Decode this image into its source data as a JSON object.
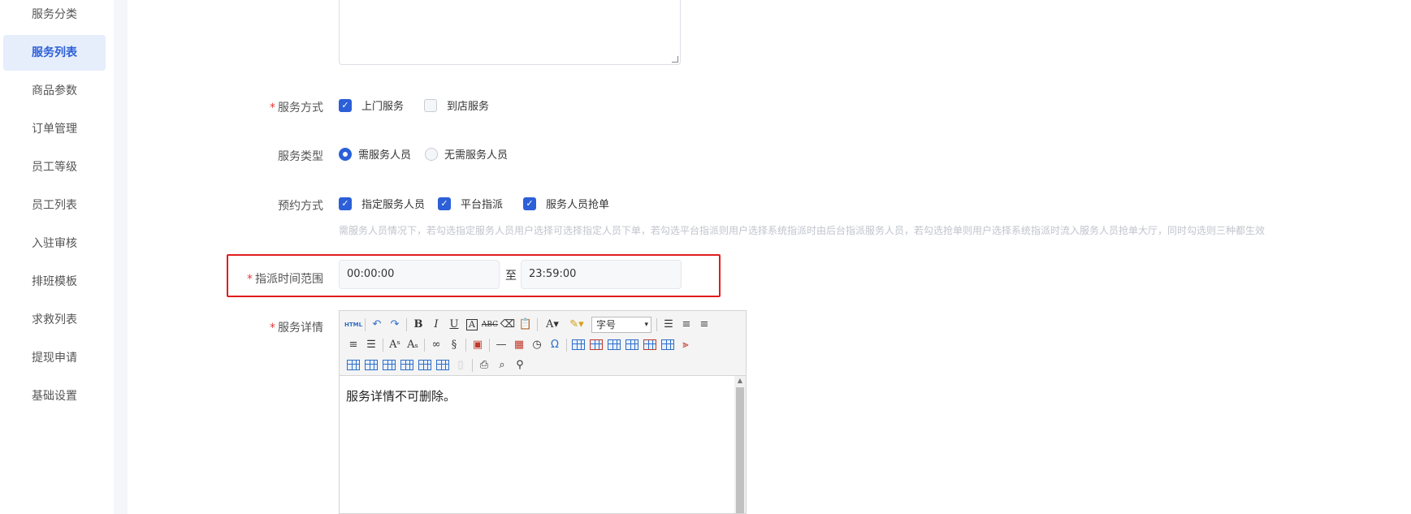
{
  "sidebar": {
    "items": [
      {
        "label": "服务分类",
        "active": false
      },
      {
        "label": "服务列表",
        "active": true
      },
      {
        "label": "商品参数",
        "active": false
      },
      {
        "label": "订单管理",
        "active": false
      },
      {
        "label": "员工等级",
        "active": false
      },
      {
        "label": "员工列表",
        "active": false
      },
      {
        "label": "入驻审核",
        "active": false
      },
      {
        "label": "排班模板",
        "active": false
      },
      {
        "label": "求救列表",
        "active": false
      },
      {
        "label": "提现申请",
        "active": false
      },
      {
        "label": "基础设置",
        "active": false
      }
    ]
  },
  "form": {
    "required_mark": "*",
    "service_method": {
      "label": "服务方式",
      "options": [
        {
          "label": "上门服务",
          "checked": true
        },
        {
          "label": "到店服务",
          "checked": false
        }
      ]
    },
    "service_type": {
      "label": "服务类型",
      "options": [
        {
          "label": "需服务人员",
          "selected": true
        },
        {
          "label": "无需服务人员",
          "selected": false
        }
      ]
    },
    "booking_method": {
      "label": "预约方式",
      "options": [
        {
          "label": "指定服务人员",
          "checked": true
        },
        {
          "label": "平台指派",
          "checked": true
        },
        {
          "label": "服务人员抢单",
          "checked": true
        }
      ],
      "hint": "需服务人员情况下，若勾选指定服务人员用户选择可选择指定人员下单，若勾选平台指派则用户选择系统指派时由后台指派服务人员，若勾选抢单则用户选择系统指派时流入服务人员抢单大厅，同时勾选则三种都生效"
    },
    "dispatch_time": {
      "label": "指派时间范围",
      "start": "00:00:00",
      "separator": "至",
      "end": "23:59:00"
    },
    "service_detail": {
      "label": "服务详情",
      "font_size_placeholder": "字号",
      "html_button": "HTML",
      "content": "服务详情不可删除。"
    }
  },
  "colors": {
    "accent": "#2c5fd8",
    "highlight_border": "#e11d1d",
    "required": "#e4393c"
  }
}
